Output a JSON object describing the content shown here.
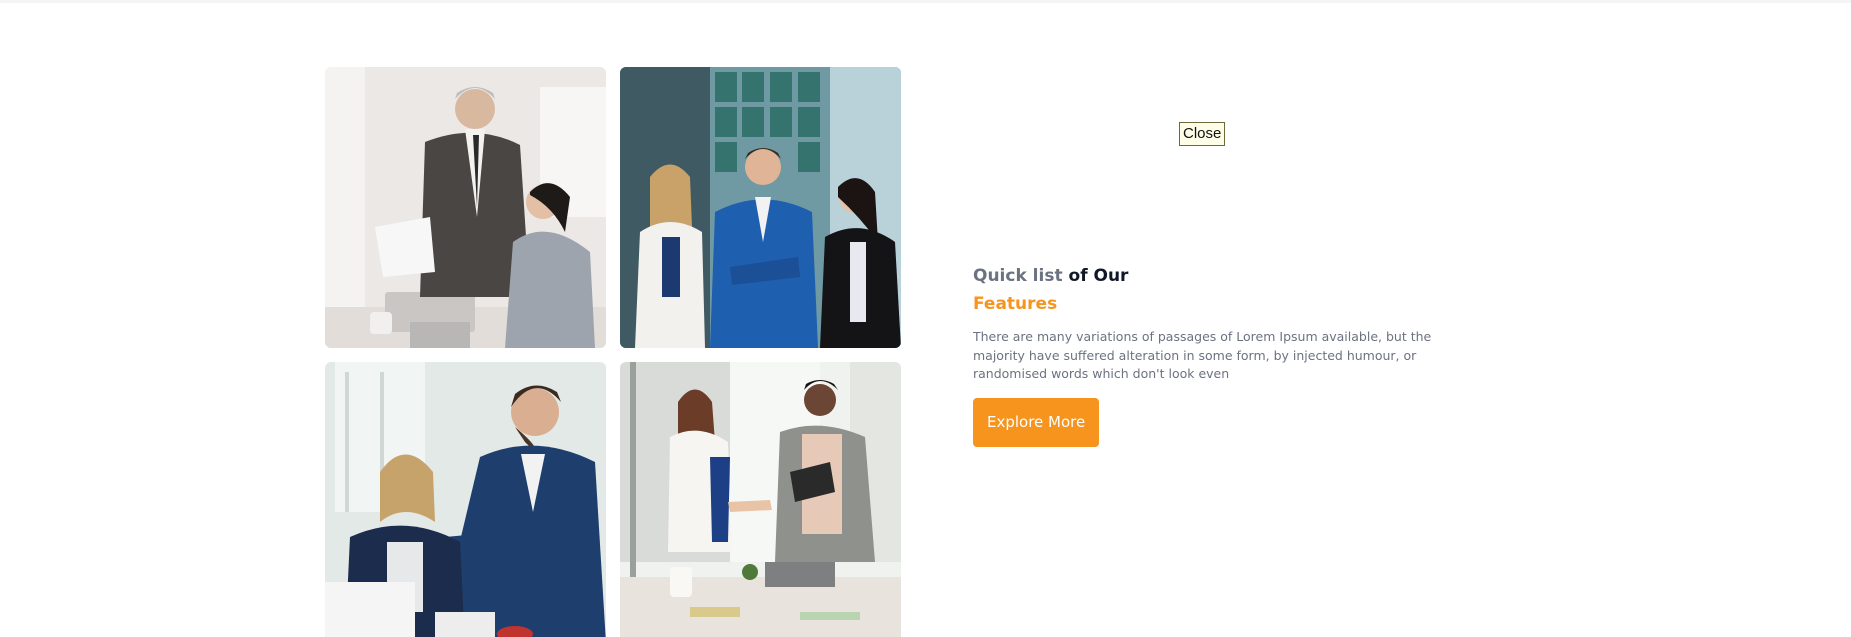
{
  "close_label": "Close",
  "features": {
    "heading_part1": "Quick list",
    "heading_part2": " of Our",
    "heading_part3": "Features",
    "description": "There are many variations of passages of Lorem Ipsum available, but the majority have suffered alteration in some form, by injected humour, or randomised words which don't look even",
    "cta_label": "Explore More"
  },
  "colors": {
    "accent": "#f7941d",
    "muted_text": "#6b7280",
    "dark_text": "#111827"
  }
}
